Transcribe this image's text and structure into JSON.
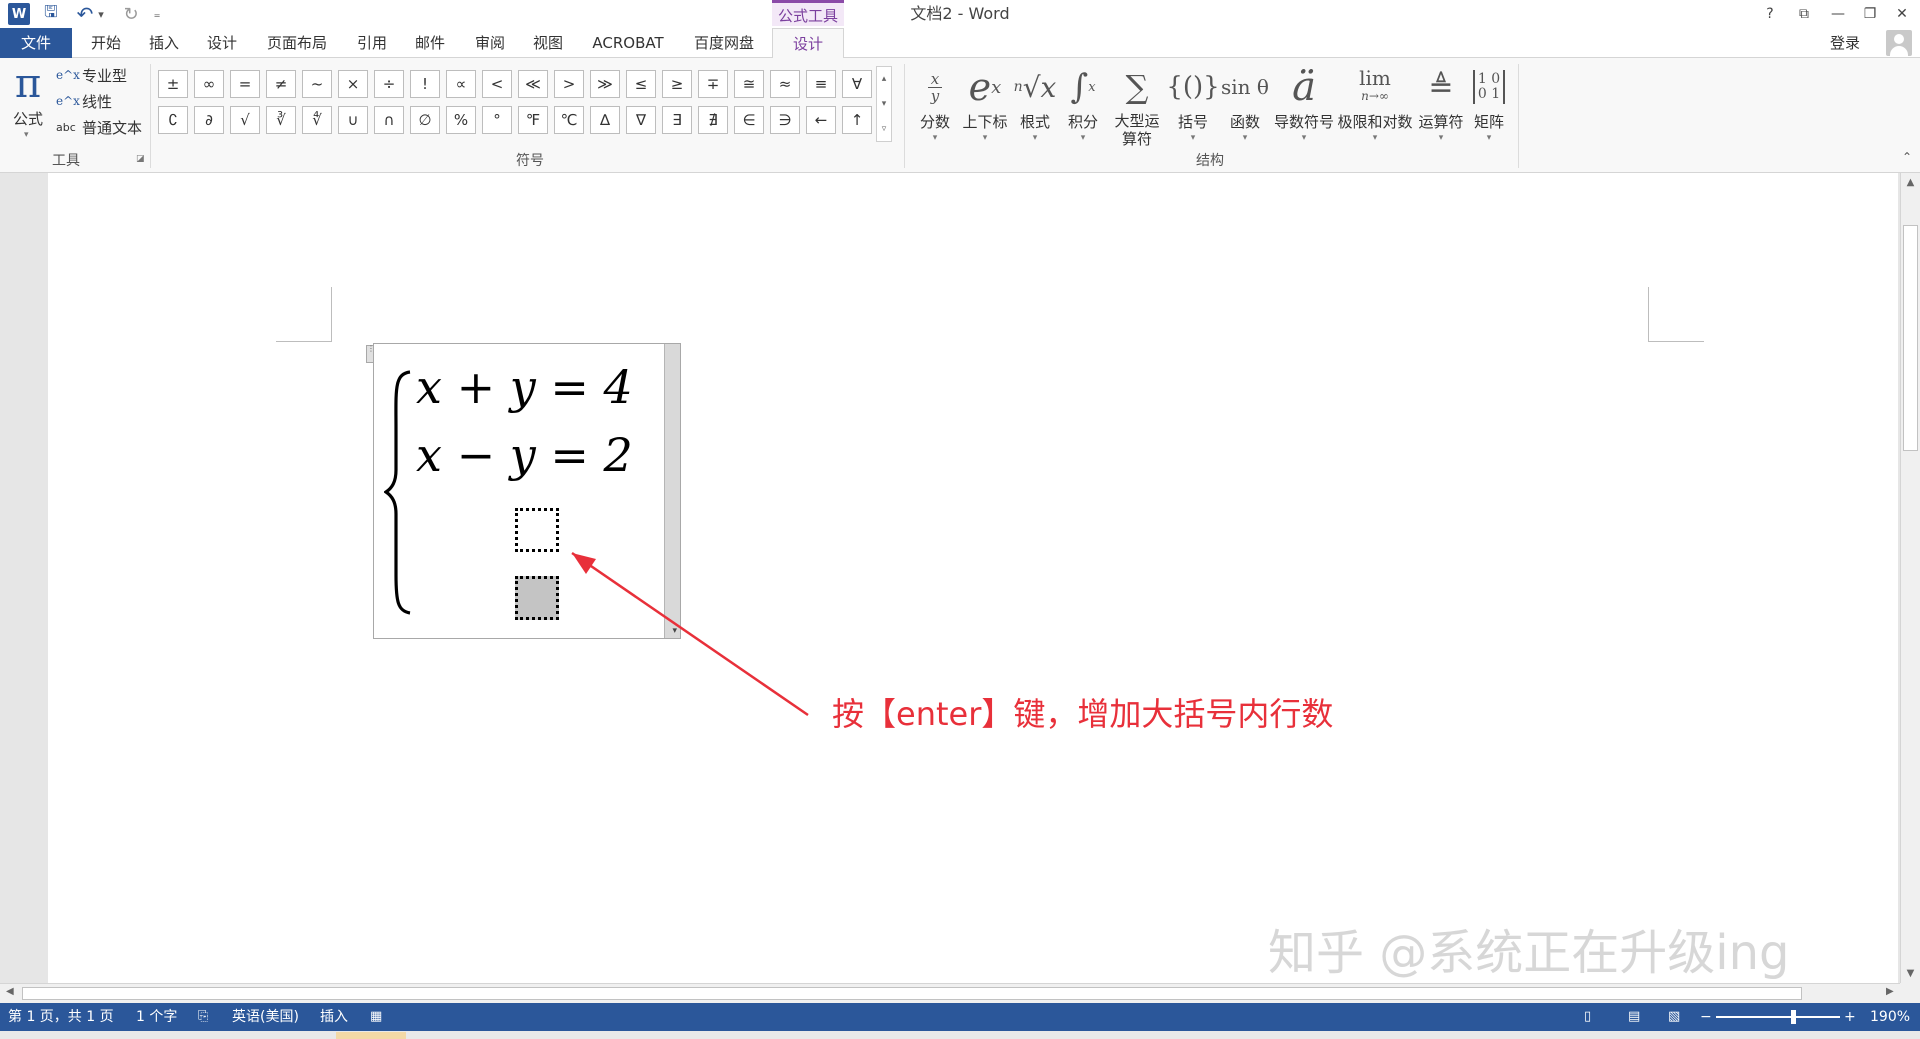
{
  "titlebar": {
    "title": "文档2 - Word",
    "contextual_group": "公式工具",
    "quick_access": [
      {
        "name": "word-logo-icon",
        "glyph": "W"
      },
      {
        "name": "save-icon",
        "glyph": "🖫"
      },
      {
        "name": "undo-icon",
        "glyph": "↶"
      },
      {
        "name": "undo-dropdown-icon",
        "glyph": "▾"
      },
      {
        "name": "redo-icon",
        "glyph": "↻"
      },
      {
        "name": "customize-qa-icon",
        "glyph": "₌"
      }
    ],
    "window_buttons": [
      "?",
      "⧉",
      "—",
      "❐",
      "✕"
    ]
  },
  "tabs": {
    "file": "文件",
    "home": "开始",
    "insert": "插入",
    "design": "设计",
    "layout": "页面布局",
    "references": "引用",
    "mailings": "邮件",
    "review": "审阅",
    "view": "视图",
    "acrobat": "ACROBAT",
    "baidu": "百度网盘",
    "equation_design": "设计",
    "login": "登录"
  },
  "ribbon": {
    "tools": {
      "group_label": "工具",
      "formula_label": "公式",
      "professional": "专业型",
      "linear": "线性",
      "plain_text": "普通文本",
      "plain_text_icon": "abc"
    },
    "symbols": {
      "group_label": "符号",
      "row1": [
        "±",
        "∞",
        "=",
        "≠",
        "~",
        "×",
        "÷",
        "!",
        "∝",
        "<",
        "≪",
        ">",
        "≫",
        "≤",
        "≥",
        "∓",
        "≅",
        "≈",
        "≡",
        "∀"
      ],
      "row2": [
        "∁",
        "∂",
        "√",
        "∛",
        "∜",
        "∪",
        "∩",
        "∅",
        "%",
        "°",
        "℉",
        "℃",
        "∆",
        "∇",
        "∃",
        "∄",
        "∈",
        "∋",
        "←",
        "↑"
      ]
    },
    "structures": {
      "group_label": "结构",
      "items": [
        {
          "label": "分数",
          "glyph": "x/y"
        },
        {
          "label": "上下标",
          "glyph": "eˣ"
        },
        {
          "label": "根式",
          "glyph": "ⁿ√x"
        },
        {
          "label": "积分",
          "glyph": "∫"
        },
        {
          "label": "大型运算符",
          "glyph": "∑"
        },
        {
          "label": "括号",
          "glyph": "{()}"
        },
        {
          "label": "函数",
          "glyph": "sin θ"
        },
        {
          "label": "导数符号",
          "glyph": "ä"
        },
        {
          "label": "极限和对数",
          "glyph": "lim"
        },
        {
          "label": "运算符",
          "glyph": "≜"
        },
        {
          "label": "矩阵",
          "glyph": "[10;01]"
        }
      ]
    }
  },
  "equation": {
    "line1": "x + y = 4",
    "line2": "x − y = 2"
  },
  "annotation": "按【enter】键，增加大括号内行数",
  "watermark": "知乎 @系统正在升级ing",
  "statusbar": {
    "page": "第 1 页，共 1 页",
    "words": "1 个字",
    "language": "英语(美国)",
    "mode": "插入",
    "zoom": "190%",
    "zoom_fraction": 0.62
  },
  "colors": {
    "accent": "#2b579a",
    "contextual": "#7b3f9e",
    "annotation": "#e8303a"
  }
}
